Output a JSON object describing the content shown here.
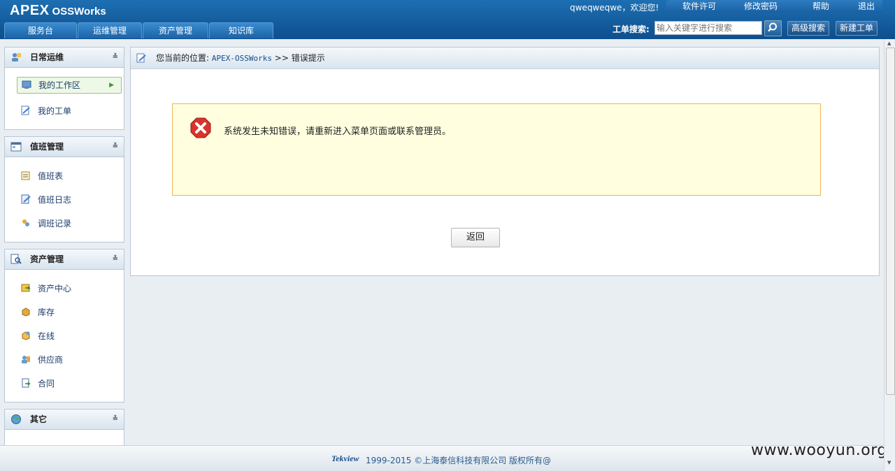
{
  "header": {
    "logo_main": "APEX",
    "logo_sub": "OSSWorks",
    "welcome": "qweqweqwe，欢迎您!",
    "top_links": [
      "软件许可",
      "修改密码",
      "帮助",
      "退出"
    ],
    "tabs": [
      "服务台",
      "运维管理",
      "资产管理",
      "知识库"
    ],
    "search_label": "工单搜索:",
    "search_placeholder": "输入关键字进行搜索",
    "advanced_search": "高级搜索",
    "new_ticket": "新建工单"
  },
  "sidebar": {
    "daily": {
      "title": "日常运维",
      "items": [
        "我的工作区",
        "我的工单"
      ]
    },
    "duty": {
      "title": "值班管理",
      "items": [
        "值班表",
        "值班日志",
        "调班记录"
      ]
    },
    "assets": {
      "title": "资产管理",
      "items": [
        "资产中心",
        "库存",
        "在线",
        "供应商",
        "合同"
      ]
    },
    "other": {
      "title": "其它"
    }
  },
  "main": {
    "crumb_prefix": "您当前的位置:",
    "crumb_link": "APEX-OSSWorks",
    "crumb_sep": ">>",
    "crumb_current": "错误提示",
    "error_message": "系统发生未知错误，请重新进入菜单页面或联系管理员。",
    "back_button": "返回"
  },
  "footer": {
    "logo": "Tekview",
    "copyright": "1999-2015 ©上海泰信科技有限公司 版权所有@"
  },
  "watermark": "www.wooyun.org",
  "colors": {
    "header": "#0d4f8e",
    "error_bg": "#ffffe0",
    "error_border": "#f0b45a",
    "error_icon": "#d9342b"
  }
}
